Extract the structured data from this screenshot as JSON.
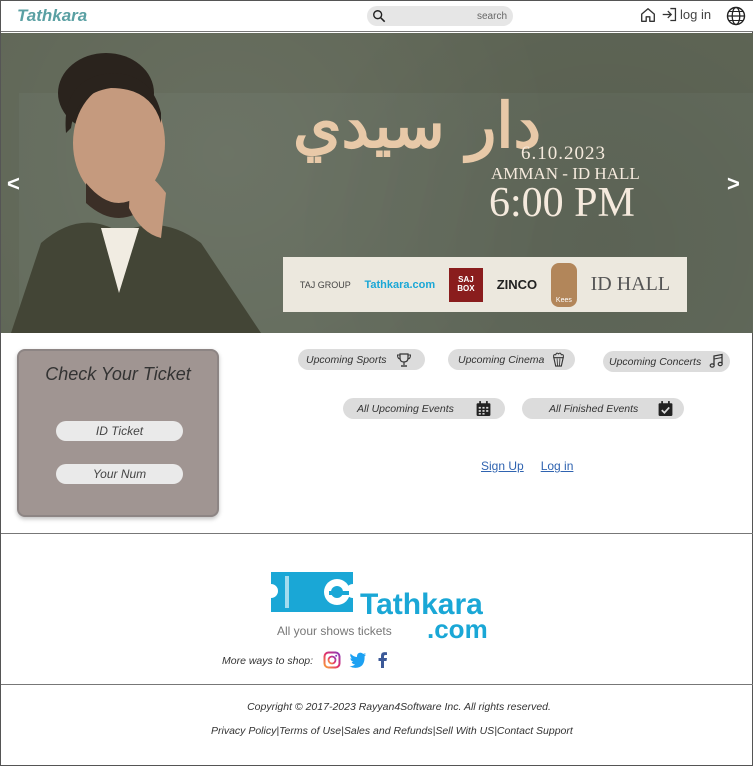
{
  "header": {
    "brand": "Tathkara",
    "search_placeholder": "search",
    "login_label": "log in"
  },
  "banner": {
    "prev": "<",
    "next": ">",
    "title_ar": "دار سيدي",
    "date": "6.10.2023",
    "place": "AMMAN - ID HALL",
    "time": "6:00 PM",
    "sponsors": [
      "TAJ GROUP",
      "Tathkara.com",
      "SAJ BOX",
      "ZINCO",
      "Kees",
      "ID HALL"
    ]
  },
  "check_ticket": {
    "title": "Check Your Ticket",
    "id_placeholder": "ID Ticket",
    "num_placeholder": "Your Num"
  },
  "categories": {
    "sports": "Upcoming Sports",
    "cinema": "Upcoming Cinema",
    "concerts": "Upcoming Concerts",
    "upcoming_all": "All Upcoming Events",
    "finished_all": "All Finished Events"
  },
  "auth_links": {
    "signup": "Sign Up",
    "login": "Log in"
  },
  "footer": {
    "logo_word": "Tathkara",
    "logo_tag": "All your shows tickets",
    "logo_com": ".com",
    "more_ways": "More ways to shop:",
    "copyright": "Copyright © 2017-2023 Rayyan4Software Inc. All rights reserved.",
    "legal": [
      "Privacy Policy",
      "Terms of Use",
      "Sales and Refunds",
      "Sell With US",
      "Contact Support"
    ]
  },
  "colors": {
    "brand": "#5aa0a3",
    "card_bg": "#a09592",
    "pill_bg": "#dcdcdc",
    "link": "#2f63b0",
    "logo_blue": "#1aa7d6"
  }
}
